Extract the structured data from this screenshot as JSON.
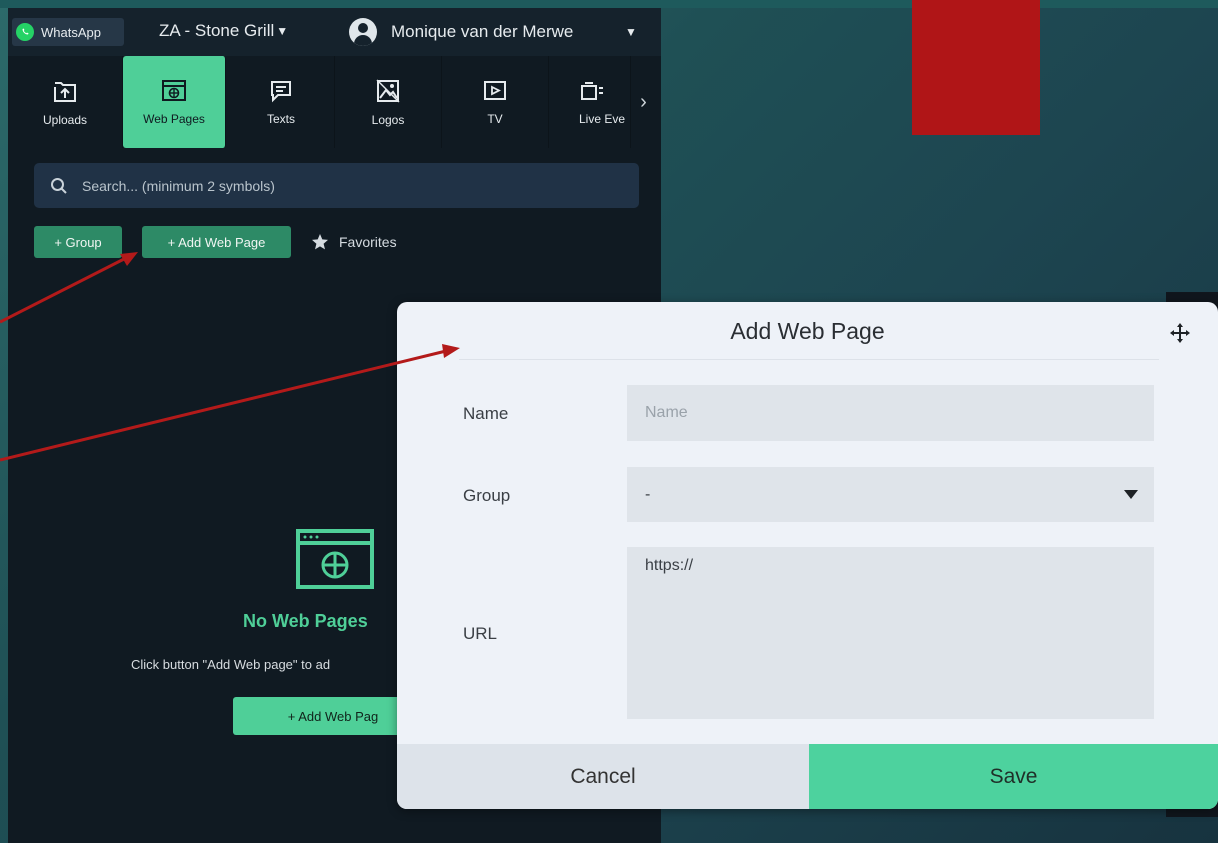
{
  "topbar": {
    "whatsapp_label": "WhatsApp",
    "location": "ZA - Stone Grill",
    "user_name": "Monique van der Merwe"
  },
  "tabs": [
    {
      "label": "Uploads",
      "icon": "upload-icon"
    },
    {
      "label": "Web Pages",
      "icon": "web-page-icon",
      "active": true
    },
    {
      "label": "Texts",
      "icon": "text-icon"
    },
    {
      "label": "Logos",
      "icon": "image-icon"
    },
    {
      "label": "TV",
      "icon": "tv-icon"
    },
    {
      "label": "Live Eve",
      "icon": "live-event-icon"
    }
  ],
  "search": {
    "placeholder": "Search... (minimum 2 symbols)"
  },
  "actions": {
    "group_button": "+ Group",
    "add_button": "+ Add Web Page",
    "favorites": "Favorites"
  },
  "empty_state": {
    "title": "No Web Pages",
    "text": "Click button \"Add Web page\" to ad",
    "button": "+ Add Web Pag"
  },
  "modal": {
    "title": "Add Web Page",
    "name_label": "Name",
    "name_placeholder": "Name",
    "group_label": "Group",
    "group_value": "-",
    "url_label": "URL",
    "url_value": "https://",
    "cancel": "Cancel",
    "save": "Save"
  },
  "colors": {
    "accent": "#4fcf98",
    "accent_dark": "#2d8a66",
    "panel": "#101a22",
    "annotation_arrow": "#b31a1a"
  }
}
